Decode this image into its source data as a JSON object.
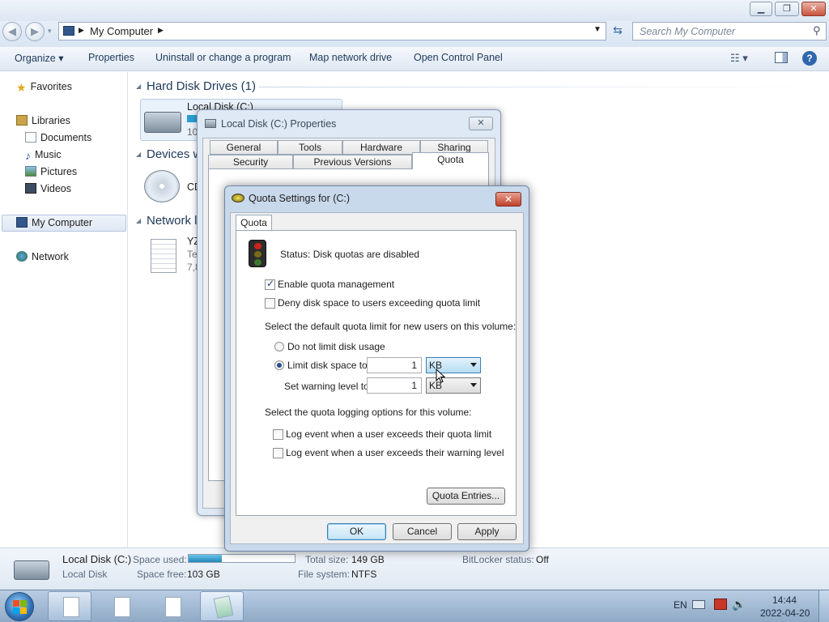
{
  "explorer": {
    "address": {
      "location": "My Computer"
    },
    "search": {
      "placeholder": "Search My Computer"
    },
    "toolbar": {
      "organize": "Organize",
      "properties": "Properties",
      "uninstall": "Uninstall or change a program",
      "map_drive": "Map network drive",
      "control_panel": "Open Control Panel"
    },
    "nav": {
      "favorites": "Favorites",
      "libraries": "Libraries",
      "documents": "Documents",
      "music": "Music",
      "pictures": "Pictures",
      "videos": "Videos",
      "my_computer": "My Computer",
      "network": "Network"
    },
    "groups": {
      "hard_disk": "Hard Disk Drives (1)",
      "devices": "Devices w",
      "network": "Network l"
    },
    "items": {
      "local_disk_name": "Local Disk (C:)",
      "local_disk_free_partial": "10",
      "cd_partial": "CD",
      "file_name_partial": "YZ",
      "file_type_partial": "Te",
      "file_size_partial": "7,8"
    },
    "details": {
      "name": "Local Disk (C:)",
      "type": "Local Disk",
      "space_used_label": "Space used:",
      "space_used_fraction": 0.31,
      "space_free_label": "Space free:",
      "space_free_value": "103 GB",
      "total_size_label": "Total size:",
      "total_size_value": "149 GB",
      "filesystem_label": "File system:",
      "filesystem_value": "NTFS",
      "bitlocker_label": "BitLocker status:",
      "bitlocker_value": "Off"
    }
  },
  "properties_dialog": {
    "title": "Local Disk (C:) Properties",
    "tabs_row1": [
      "General",
      "Tools",
      "Hardware",
      "Sharing"
    ],
    "tabs_row2": [
      "Security",
      "Previous Versions",
      "Quota"
    ]
  },
  "quota_dialog": {
    "title": "Quota Settings for  (C:)",
    "tab": "Quota",
    "status": "Status:  Disk quotas are disabled",
    "enable_quota": {
      "label": "Enable quota management",
      "checked": true
    },
    "deny_space": {
      "label": "Deny disk space to users exceeding quota limit",
      "checked": false
    },
    "default_limit_heading": "Select the default quota limit for new users on this volume:",
    "no_limit": "Do not limit disk usage",
    "limit_to": "Limit disk space to",
    "limit_value": "1",
    "limit_unit": "KB",
    "warning_label": "Set warning level to",
    "warning_value": "1",
    "warning_unit": "KB",
    "logging_heading": "Select the quota logging options for this volume:",
    "log_exceed_limit": "Log event when a user exceeds their quota limit",
    "log_exceed_warning": "Log event when a user exceeds their warning level",
    "entries_button": "Quota Entries...",
    "ok": "OK",
    "cancel": "Cancel",
    "apply": "Apply"
  },
  "taskbar": {
    "language": "EN",
    "time": "14:44",
    "date": "2022-04-20"
  }
}
